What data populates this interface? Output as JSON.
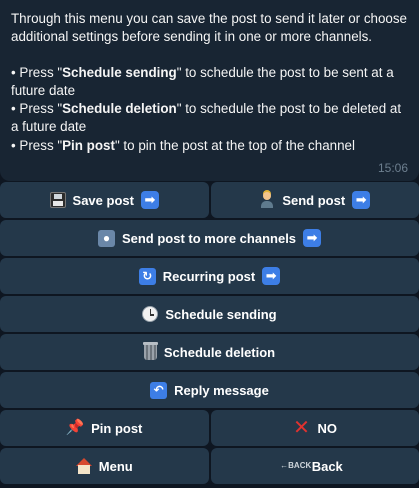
{
  "message": {
    "intro": "Through this menu you can save the post to send it later or choose additional settings before sending it in one or more channels.",
    "bullets": [
      {
        "prefix": "• Press \"",
        "strong": "Schedule sending",
        "suffix": "\" to schedule the post to be sent at a future date"
      },
      {
        "prefix": "• Press \"",
        "strong": "Schedule deletion",
        "suffix": "\" to schedule the post to be deleted at a future date"
      },
      {
        "prefix": "• Press \"",
        "strong": "Pin post",
        "suffix": "\" to pin the post at the top of the channel"
      }
    ],
    "time": "15:06"
  },
  "keyboard": {
    "save_post": "Save post",
    "send_post": "Send post",
    "send_more": "Send post to more channels",
    "recurring": "Recurring post",
    "schedule_sending": "Schedule sending",
    "schedule_deletion": "Schedule deletion",
    "reply_message": "Reply message",
    "pin_post": "Pin post",
    "no": "NO",
    "menu": "Menu",
    "back": "Back",
    "arrow_glyph": "➡",
    "back_icon_text": "BACK"
  },
  "colors": {
    "background": "#0e1621",
    "bubble": "#182533",
    "button": "#24384a",
    "accent": "#3d7ee6",
    "time": "#6d7f8f"
  },
  "icons": {
    "save_post": "floppy-disk-icon",
    "send_post": "person-icon",
    "send_more": "people-icon",
    "recurring": "repeat-icon",
    "schedule_sending": "clock-icon",
    "schedule_deletion": "wastebasket-icon",
    "reply_message": "reply-arrow-icon",
    "pin_post": "pushpin-icon",
    "no": "cross-mark-icon",
    "menu": "house-icon",
    "back": "back-arrow-icon",
    "arrow": "right-arrow-icon"
  }
}
